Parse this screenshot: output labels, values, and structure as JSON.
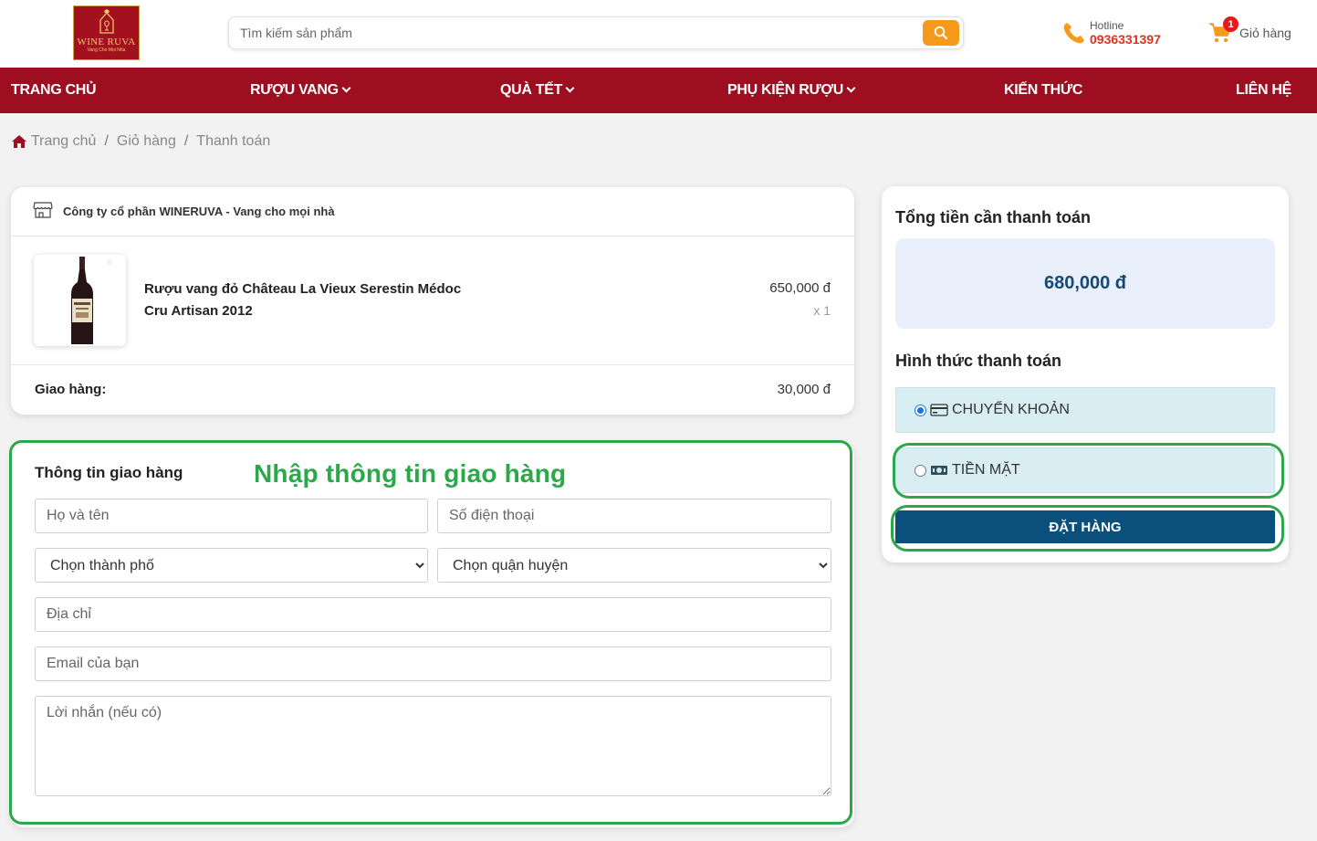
{
  "header": {
    "logo_brand": "WINE RUVA",
    "logo_tagline": "Vang Cho Mọi Nhà",
    "search_placeholder": "Tìm kiếm sản phẩm",
    "hotline_label": "Hotline",
    "hotline_number": "0936331397",
    "cart_count": "1",
    "cart_label": "Giỏ hàng"
  },
  "nav": {
    "items": [
      {
        "label": "TRANG CHỦ"
      },
      {
        "label": "RƯỢU VANG"
      },
      {
        "label": "QUÀ TẾT"
      },
      {
        "label": "PHỤ KIỆN RƯỢU"
      },
      {
        "label": "KIẾN THỨC"
      },
      {
        "label": "LIÊN HỆ"
      }
    ]
  },
  "breadcrumb": {
    "home": "Trang chủ",
    "cart": "Giỏ hàng",
    "current": "Thanh toán",
    "sep": "/"
  },
  "order": {
    "company": "Công ty cổ phần WINERUVA - Vang cho mọi nhà",
    "product_name": "Rượu vang đỏ Château La Vieux Serestin Médoc Cru Artisan 2012",
    "product_price": "650,000 đ",
    "product_qty": "x 1",
    "shipping_label": "Giao hàng:",
    "shipping_fee": "30,000 đ"
  },
  "shipping_form": {
    "title": "Thông tin giao hàng",
    "name_placeholder": "Họ và tên",
    "phone_placeholder": "Số điện thoại",
    "city_selected": "Chọn thành phố",
    "district_selected": "Chọn quận huyện",
    "address_placeholder": "Địa chỉ",
    "email_placeholder": "Email của bạn",
    "note_placeholder": "Lời nhắn (nếu có)"
  },
  "annotation": {
    "text": "Nhập thông tin giao hàng",
    "color": "#2aa84a"
  },
  "summary": {
    "total_title": "Tổng tiền cần thanh toán",
    "total_value": "680,000 đ",
    "payment_title": "Hình thức thanh toán",
    "payment_options": [
      {
        "label": "CHUYỂN KHOẢN",
        "selected": true,
        "icon": "credit-card-icon"
      },
      {
        "label": "TIỀN MẶT",
        "selected": false,
        "icon": "cash-icon"
      }
    ],
    "order_button": "ĐẶT HÀNG"
  },
  "colors": {
    "brand_red": "#9d0f20",
    "search_orange": "#f59a1b",
    "order_button": "#0b4f7d",
    "total_text": "#144a78",
    "hotline_red": "#e0311f"
  }
}
